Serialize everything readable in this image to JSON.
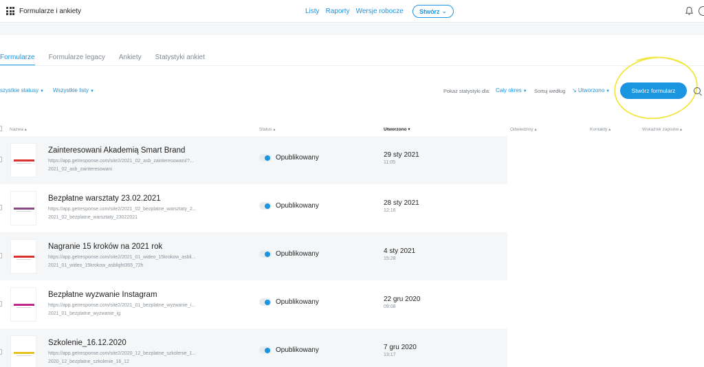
{
  "app": {
    "title": "Formularze i ankiety"
  },
  "topnav": [
    "Listy",
    "Raporty",
    "Wersje robocze"
  ],
  "create_label": "Stwórz",
  "tabs": [
    "Formularze",
    "Formularze legacy",
    "Ankiety",
    "Statystyki ankiet"
  ],
  "filters": {
    "statuses": "szystkie statusy",
    "lists": "Wszystkie listy",
    "stats_label": "Pokaż statystyki dla:",
    "stats_value": "Cały okres",
    "sort_label": "Sortuj według",
    "sort_value": "↘ Utworzono"
  },
  "create_form_label": "Stwórz formularz",
  "columns": {
    "name": "Nazwa ▴",
    "status": "Status ▴",
    "created": "Utworzono ▾",
    "visits": "Odwiedziny ▴",
    "contacts": "Kontakty ▴",
    "rate": "Wskaźnik zapisów ▴"
  },
  "rows": [
    {
      "title": "Zainteresowani Akademią Smart Brand",
      "url": "https://app.getresponse.com/site2/2021_02_asb_zainteresowani/?...",
      "slug": "2021_02_asb_zainteresowani",
      "status": "Opublikowany",
      "date": "29 sty 2021",
      "time": "11:05",
      "thumb_color": "#d9302c"
    },
    {
      "title": "Bezpłatne warsztaty 23.02.2021",
      "url": "https://app.getresponse.com/site2/2021_02_bezplatne_warsztaty_2...",
      "slug": "2021_02_bezplatne_warsztaty_23022021",
      "status": "Opublikowany",
      "date": "28 sty 2021",
      "time": "12:16",
      "thumb_color": "#8a4a86"
    },
    {
      "title": "Nagranie 15 kroków na 2021 rok",
      "url": "https://app.getresponse.com/site2/2021_01_wideo_15krokow_asbli...",
      "slug": "2021_01_wideo_15krokow_asblight365_72h",
      "status": "Opublikowany",
      "date": "4 sty 2021",
      "time": "15:28",
      "thumb_color": "#d9302c"
    },
    {
      "title": "Bezpłatne wyzwanie Instagram",
      "url": "https://app.getresponse.com/site2/2021_01_bezplatne_wyzwanie_i...",
      "slug": "2021_01_bezplatne_wyzwanie_ig",
      "status": "Opublikowany",
      "date": "22 gru 2020",
      "time": "09:08",
      "thumb_color": "#c2248a"
    },
    {
      "title": "Szkolenie_16.12.2020",
      "url": "https://app.getresponse.com/site2/2020_12_bezplatne_szkolenie_1...",
      "slug": "2020_12_bezplatne_szkolenie_16_12",
      "status": "Opublikowany",
      "date": "7 gru 2020",
      "time": "13:17",
      "thumb_color": "#e6c21a"
    }
  ],
  "colors": {
    "accent": "#1a95e0",
    "highlight": "#f2e640"
  }
}
